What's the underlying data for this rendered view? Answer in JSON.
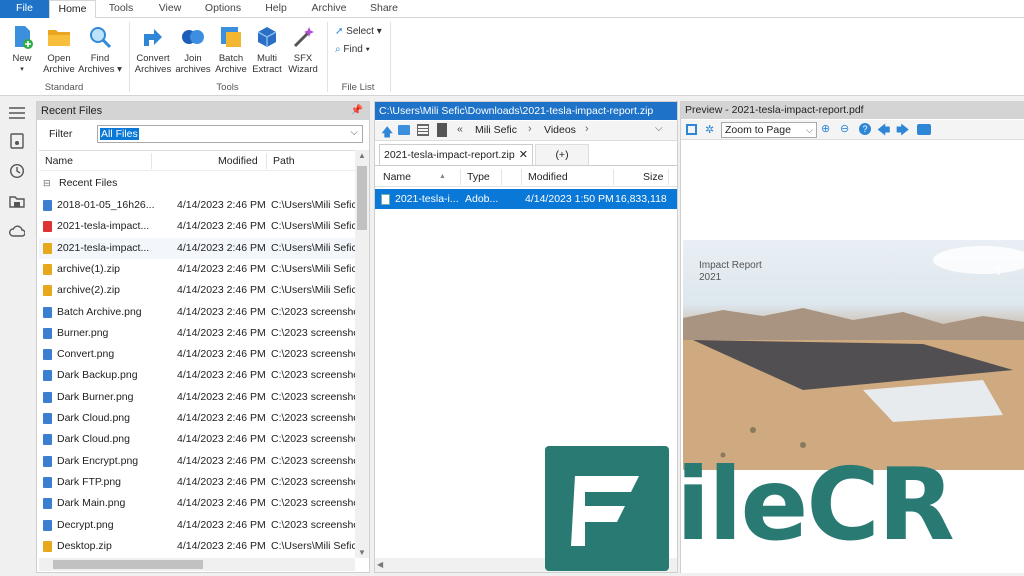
{
  "tabs": {
    "file": "File",
    "home": "Home",
    "tools": "Tools",
    "view": "View",
    "options": "Options",
    "help": "Help",
    "archive": "Archive",
    "share": "Share"
  },
  "ribbon": {
    "new": "New",
    "open": [
      "Open",
      "Archive"
    ],
    "find_archives": [
      "Find",
      "Archives"
    ],
    "convert": [
      "Convert",
      "Archives"
    ],
    "join": [
      "Join",
      "archives"
    ],
    "batch": [
      "Batch",
      "Archive"
    ],
    "multi": [
      "Multi",
      "Extract"
    ],
    "sfx": [
      "SFX",
      "Wizard"
    ],
    "select": "Select",
    "find": "Find",
    "groups": {
      "standard": "Standard",
      "tools": "Tools",
      "file_list": "File List"
    }
  },
  "recent": {
    "title": "Recent Files",
    "filter_label": "Filter",
    "filter_value": "All Files",
    "columns": {
      "name": "Name",
      "modified": "Modified",
      "path": "Path"
    },
    "group_label": "Recent Files",
    "rows": [
      {
        "name": "2018-01-05_16h26...",
        "modified": "4/14/2023 2:46 PM",
        "path": "C:\\Users\\Mili Sefic",
        "kind": "image"
      },
      {
        "name": "2021-tesla-impact...",
        "modified": "4/14/2023 2:46 PM",
        "path": "C:\\Users\\Mili Sefic",
        "kind": "pdf"
      },
      {
        "name": "2021-tesla-impact...",
        "modified": "4/14/2023 2:46 PM",
        "path": "C:\\Users\\Mili Sefic",
        "kind": "zip"
      },
      {
        "name": "archive(1).zip",
        "modified": "4/14/2023 2:46 PM",
        "path": "C:\\Users\\Mili Sefic",
        "kind": "zip"
      },
      {
        "name": "archive(2).zip",
        "modified": "4/14/2023 2:46 PM",
        "path": "C:\\Users\\Mili Sefic",
        "kind": "zip"
      },
      {
        "name": "Batch Archive.png",
        "modified": "4/14/2023 2:46 PM",
        "path": "C:\\2023 screensho",
        "kind": "image"
      },
      {
        "name": "Burner.png",
        "modified": "4/14/2023 2:46 PM",
        "path": "C:\\2023 screensho",
        "kind": "image"
      },
      {
        "name": "Convert.png",
        "modified": "4/14/2023 2:46 PM",
        "path": "C:\\2023 screensho",
        "kind": "image"
      },
      {
        "name": "Dark Backup.png",
        "modified": "4/14/2023 2:46 PM",
        "path": "C:\\2023 screensho",
        "kind": "image"
      },
      {
        "name": "Dark Burner.png",
        "modified": "4/14/2023 2:46 PM",
        "path": "C:\\2023 screensho",
        "kind": "image"
      },
      {
        "name": "Dark Cloud.png",
        "modified": "4/14/2023 2:46 PM",
        "path": "C:\\2023 screensho",
        "kind": "image"
      },
      {
        "name": "Dark Cloud.png",
        "modified": "4/14/2023 2:46 PM",
        "path": "C:\\2023 screensho",
        "kind": "image"
      },
      {
        "name": "Dark Encrypt.png",
        "modified": "4/14/2023 2:46 PM",
        "path": "C:\\2023 screensho",
        "kind": "image"
      },
      {
        "name": "Dark FTP.png",
        "modified": "4/14/2023 2:46 PM",
        "path": "C:\\2023 screensho",
        "kind": "image"
      },
      {
        "name": "Dark Main.png",
        "modified": "4/14/2023 2:46 PM",
        "path": "C:\\2023 screensho",
        "kind": "image"
      },
      {
        "name": "Decrypt.png",
        "modified": "4/14/2023 2:46 PM",
        "path": "C:\\2023 screensho",
        "kind": "image"
      },
      {
        "name": "Desktop.zip",
        "modified": "4/14/2023 2:46 PM",
        "path": "C:\\Users\\Mili Sefic",
        "kind": "zip"
      }
    ]
  },
  "archive_pane": {
    "title": "C:\\Users\\Mili Sefic\\Downloads\\2021-tesla-impact-report.zip",
    "breadcrumb": {
      "chevrons": "«",
      "user": "Mili Sefic",
      "sep": "›",
      "folder": "Videos"
    },
    "tab_name": "2021-tesla-impact-report.zip",
    "tab_close": "✕",
    "tab_new": "(+)",
    "columns": {
      "name": "Name",
      "type": "Type",
      "modified": "Modified",
      "size": "Size"
    },
    "rows": [
      {
        "name": "2021-tesla-i...",
        "type": "Adob...",
        "modified": "4/14/2023 1:50 PM",
        "size": "16,833,118"
      }
    ]
  },
  "preview": {
    "title": "Preview - 2021-tesla-impact-report.pdf",
    "zoom": "Zoom to Page",
    "doc_title": "Impact Report",
    "doc_year": "2021",
    "doc_letter": "T"
  },
  "watermark": {
    "text": "ileCR"
  },
  "colors": {
    "accent": "#1e73c8",
    "selection": "#0a78d7",
    "watermark": "#2a7a74"
  }
}
